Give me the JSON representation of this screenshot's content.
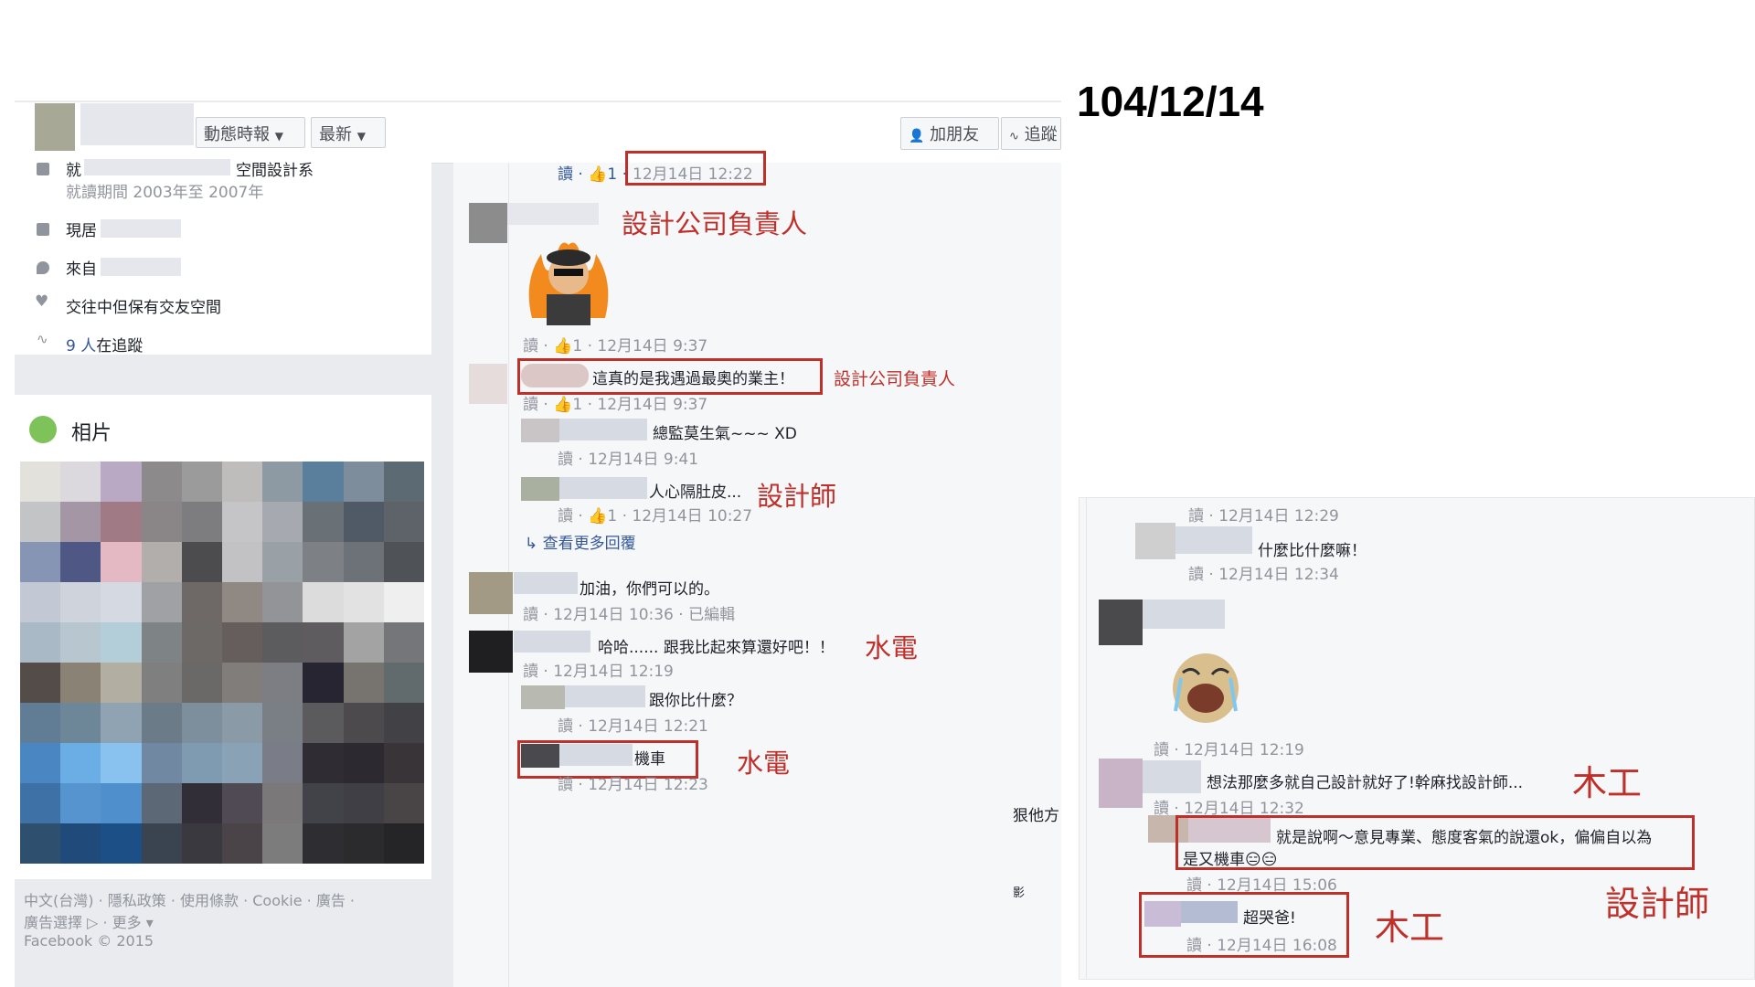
{
  "date_label": "104/12/14",
  "topbar": {
    "timeline_label": "動態時報",
    "latest_label": "最新",
    "add_friend_label": "加朋友",
    "follow_label": "追蹤"
  },
  "intro": {
    "school_line": "就",
    "school_dept": "空間設計系",
    "school_period": "就讀期間 2003年至 2007年",
    "lives_label": "現居",
    "from_label": "來自",
    "relationship": "交往中但保有交友空間",
    "followers_count": "9 人",
    "followers_suffix": "在追蹤"
  },
  "photos": {
    "title": "相片",
    "colors": [
      "#e2e1dc",
      "#dcd9de",
      "#b9a9c4",
      "#8c8a8b",
      "#9c9b9b",
      "#bfbdbc",
      "#8d9aa4",
      "#5a7f9c",
      "#7d8d9b",
      "#5c6a74",
      "#c2c4c6",
      "#a596a6",
      "#a07a85",
      "#8a8688",
      "#7d7d7f",
      "#c5c5c7",
      "#a6aab0",
      "#6a7176",
      "#4f5a66",
      "#5d6369",
      "#8595b3",
      "#4f5784",
      "#e4b9c4",
      "#b1aeac",
      "#4c4c4f",
      "#c2c2c4",
      "#99a0a6",
      "#7d8186",
      "#6c7278",
      "#4f5257",
      "#c3c9d4",
      "#cfd3dc",
      "#d5d9e2",
      "#9fa1a4",
      "#6e6966",
      "#8f8883",
      "#929497",
      "#dcdcdd",
      "#e2e2e2",
      "#efefef",
      "#a9b9c5",
      "#b7c6cf",
      "#b3cdd9",
      "#7e8385",
      "#6d6967",
      "#655e5d",
      "#5c5b5d",
      "#5e5c5e",
      "#a3a3a3",
      "#747679",
      "#544c49",
      "#8a8275",
      "#b3aea2",
      "#7f7f7f",
      "#6b6868",
      "#807d7b",
      "#7d7e84",
      "#282533",
      "#77746f",
      "#616b6d",
      "#607d95",
      "#6d8799",
      "#8fa3b2",
      "#6c7b88",
      "#7d8f9c",
      "#8a9aa7",
      "#7a7f85",
      "#5b5a5d",
      "#4c4a4d",
      "#424246",
      "#4a86c2",
      "#6aaee5",
      "#89c2ef",
      "#7088a2",
      "#7f9bb1",
      "#8aa2b6",
      "#7a7d88",
      "#302c33",
      "#2c2a30",
      "#383438",
      "#3e71a5",
      "#5594cf",
      "#4f8fcc",
      "#5c6875",
      "#322e38",
      "#4f4a54",
      "#7a7878",
      "#414349",
      "#3f3f45",
      "#494546",
      "#2f4f6e",
      "#1f4a7a",
      "#1c4f86",
      "#3a4350",
      "#3b3940",
      "#4a4448",
      "#7c7c7c",
      "#2e2e32",
      "#2b2b2e",
      "#252528"
    ]
  },
  "footer": {
    "line1": "中文(台灣) · 隱私政策 · 使用條款 · Cookie · 廣告 ·",
    "line2": "廣告選擇 ▷ · 更多 ▾",
    "line3": "Facebook © 2015"
  },
  "left_comments": {
    "top_meta": "讀 · 👍1 ·",
    "top_time": "12月14日 12:22",
    "c1_meta": "讀 · 👍1 · 12月14日 9:37",
    "c2_text": "這真的是我遇過最奧的業主！",
    "c2_meta": "讀 · 👍1 · 12月14日 9:37",
    "r1_text": "總監莫生氣~~~ XD",
    "r1_meta": "讀 · 12月14日 9:41",
    "r2_text": "人心隔肚皮...",
    "r2_meta": "讀 · 👍1 · 12月14日 10:27",
    "more_replies": "↳ 查看更多回覆",
    "c3_text": "加油，你們可以的。",
    "c3_meta": "讀 · 12月14日 10:36 · 已編輯",
    "c4_text": "哈哈...... 跟我比起來算還好吧！！",
    "c4_meta": "讀 · 12月14日 12:19",
    "r3_text": "跟你比什麼？",
    "r3_meta": "讀 · 12月14日 12:21",
    "r4_text": "機車",
    "r4_meta": "讀 · 12月14日 12:23",
    "edge_text1": "狠他方",
    "edge_text2": "影"
  },
  "left_annotations": {
    "a1": "設計公司負責人",
    "a2": "設計公司負責人",
    "a3": "設計師",
    "a4": "水電",
    "a5": "水電"
  },
  "right_comments": {
    "m1": "讀 · 12月14日 12:29",
    "t1": "什麼比什麼嘛！",
    "m2": "讀 · 12月14日 12:34",
    "m3": "讀 · 12月14日 12:19",
    "t2": "想法那麼多就自己設計就好了!幹麻找設計師...",
    "m4": "讀 · 12月14日 12:32",
    "t3a": "就是說啊～意見專業、態度客氣的說還ok，偏偏自以為",
    "t3b": "是又機車😑😑",
    "m5": "讀 · 12月14日 15:06",
    "t4": "超哭爸!",
    "m6": "讀 · 12月14日 16:08"
  },
  "right_annotations": {
    "a1": "木工",
    "a2": "設計師",
    "a3": "木工"
  }
}
